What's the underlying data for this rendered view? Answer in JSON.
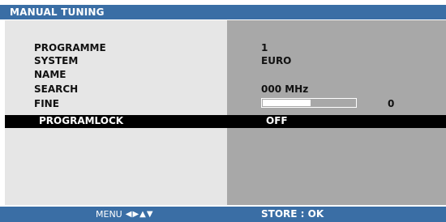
{
  "window": {
    "title": "MANUAL TUNING"
  },
  "settings": [
    {
      "label": "PROGRAMME",
      "value": "1"
    },
    {
      "label": "SYSTEM",
      "value": "EURO"
    },
    {
      "label": "NAME",
      "value": ""
    },
    {
      "label": "SEARCH",
      "value": "000 MHz"
    },
    {
      "label": "FINE",
      "value": "0",
      "bar_level": 0.52
    },
    {
      "label": "PROGRAMLOCK",
      "value": "OFF",
      "selected": true
    }
  ],
  "footer": {
    "menu_label": "MENU",
    "nav_icons": [
      "left-arrow-icon",
      "right-arrow-icon",
      "up-arrow-icon",
      "down-arrow-icon"
    ],
    "store_label": "STORE : OK"
  },
  "colors": {
    "title_bar": "#3a6ea5",
    "left_panel": "#e6e6e6",
    "right_panel": "#a8a8a8",
    "selection": "#000000"
  }
}
